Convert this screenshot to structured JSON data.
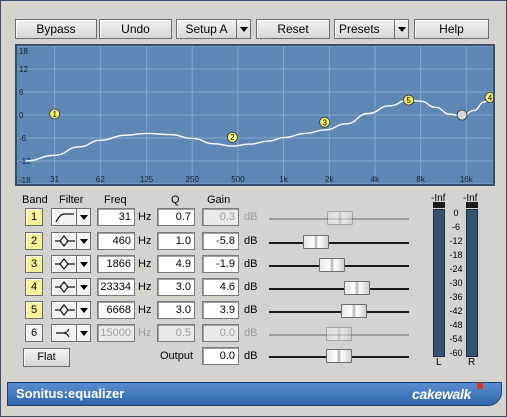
{
  "toolbar": {
    "bypass": "Bypass",
    "undo": "Undo",
    "setup": "Setup A",
    "reset": "Reset",
    "presets": "Presets",
    "help": "Help"
  },
  "graph": {
    "y_ticks": [
      "18",
      "12",
      "6",
      "0",
      "-6",
      "-12",
      "-18"
    ],
    "x_ticks": [
      "31",
      "62",
      "125",
      "250",
      "500",
      "1k",
      "2k",
      "4k",
      "8k",
      "16k"
    ],
    "background": "#5f87b5",
    "grid_color": "#86a8cf",
    "curve_color": "#ffffff",
    "node_color": "#f6f36c",
    "curve_points": [
      {
        "f": 20,
        "g": -12
      },
      {
        "f": 31,
        "g": -10.5
      },
      {
        "f": 45,
        "g": -8.3
      },
      {
        "f": 62,
        "g": -6.6
      },
      {
        "f": 90,
        "g": -5.3
      },
      {
        "f": 125,
        "g": -4.8
      },
      {
        "f": 180,
        "g": -5.1
      },
      {
        "f": 250,
        "g": -6.1
      },
      {
        "f": 350,
        "g": -7.5
      },
      {
        "f": 460,
        "g": -8.1
      },
      {
        "f": 600,
        "g": -7.6
      },
      {
        "f": 800,
        "g": -6.8
      },
      {
        "f": 1000,
        "g": -5.9
      },
      {
        "f": 1400,
        "g": -4.8
      },
      {
        "f": 1866,
        "g": -3.9
      },
      {
        "f": 2600,
        "g": -2.3
      },
      {
        "f": 3600,
        "g": 0.4
      },
      {
        "f": 5000,
        "g": 2.4
      },
      {
        "f": 6668,
        "g": 3.9
      },
      {
        "f": 8000,
        "g": 3.6
      },
      {
        "f": 10000,
        "g": 2.0
      },
      {
        "f": 12500,
        "g": 0.2
      },
      {
        "f": 15000,
        "g": -0.3
      },
      {
        "f": 18000,
        "g": 1.2
      },
      {
        "f": 21000,
        "g": 3.4
      },
      {
        "f": 23334,
        "g": 4.6
      }
    ],
    "nodes": [
      {
        "label": "1",
        "f": 31,
        "g": 0.3,
        "enabled": true
      },
      {
        "label": "2",
        "f": 460,
        "g": -5.8,
        "enabled": true
      },
      {
        "label": "3",
        "f": 1866,
        "g": -1.9,
        "enabled": true
      },
      {
        "label": "4",
        "f": 23334,
        "g": 4.6,
        "enabled": true
      },
      {
        "label": "5",
        "f": 6668,
        "g": 3.9,
        "enabled": true
      },
      {
        "label": "6",
        "f": 15000,
        "g": 0.0,
        "enabled": false
      }
    ]
  },
  "headers": {
    "band": "Band",
    "filter": "Filter",
    "freq": "Freq",
    "q": "Q",
    "gain": "Gain"
  },
  "bands": [
    {
      "num": "1",
      "filter_icon": "high-pass-icon",
      "freq": "31",
      "freq_unit": "Hz",
      "q": "0.7",
      "gain": "0.3",
      "gain_unit": "dB",
      "enabled": true,
      "gain_db": 0.3
    },
    {
      "num": "2",
      "filter_icon": "peak-icon",
      "freq": "460",
      "freq_unit": "Hz",
      "q": "1.0",
      "gain": "-5.8",
      "gain_unit": "dB",
      "enabled": true,
      "gain_db": -5.8
    },
    {
      "num": "3",
      "filter_icon": "peak-icon",
      "freq": "1866",
      "freq_unit": "Hz",
      "q": "4.9",
      "gain": "-1.9",
      "gain_unit": "dB",
      "enabled": true,
      "gain_db": -1.9
    },
    {
      "num": "4",
      "filter_icon": "peak-icon",
      "freq": "23334",
      "freq_unit": "Hz",
      "q": "3.0",
      "gain": "4.6",
      "gain_unit": "dB",
      "enabled": true,
      "gain_db": 4.6
    },
    {
      "num": "5",
      "filter_icon": "peak-icon",
      "freq": "6668",
      "freq_unit": "Hz",
      "q": "3.0",
      "gain": "3.9",
      "gain_unit": "dB",
      "enabled": true,
      "gain_db": 3.9
    },
    {
      "num": "6",
      "filter_icon": "low-pass-icon",
      "freq": "15000",
      "freq_unit": "Hz",
      "q": "0.5",
      "gain": "0.0",
      "gain_unit": "dB",
      "enabled": false,
      "gain_db": 0.0
    }
  ],
  "flat_label": "Flat",
  "output": {
    "label": "Output",
    "value": "0.0",
    "unit": "dB",
    "gain_db": 0.0
  },
  "meters": {
    "left_peak": "-Inf",
    "right_peak": "-Inf",
    "scale": [
      "0",
      "-6",
      "-12",
      "-18",
      "-24",
      "-30",
      "-36",
      "-42",
      "-48",
      "-54",
      "-60"
    ],
    "left_label": "L",
    "right_label": "R",
    "meter_color": "#35536f"
  },
  "footer": {
    "product": "Sonitus:equalizer",
    "vendor": "cakewalk",
    "bar_color": "#3f74bd"
  }
}
